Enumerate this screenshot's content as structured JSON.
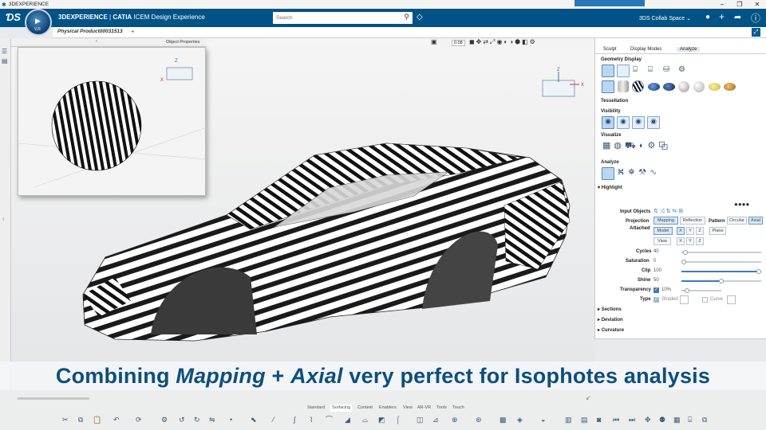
{
  "window": {
    "title": "3DEXPERIENCE",
    "minimize": "–",
    "maximize": "❐",
    "close": "✕"
  },
  "appbar": {
    "brand": "3DEXPERIENCE",
    "separator": "|",
    "product": "CATIA",
    "app": "ICEM Design Experience",
    "search_placeholder": "Search",
    "collab_space": "3DS Collab Space",
    "compass_label": "V,R"
  },
  "document": {
    "tab_label": "Physical Product00031513",
    "add_tab": "+"
  },
  "object_properties": {
    "label": "Object Properties"
  },
  "view_toolbar": {
    "zoom_value": "0.08"
  },
  "panel": {
    "tabs": [
      "Sculpt",
      "Display Modes",
      "Analyze"
    ],
    "sections": {
      "geometry_display": "Geometry Display",
      "tessellation": "Tessellation",
      "visibility": "Visibility",
      "visualize": "Visualize",
      "analyze": "Analyze",
      "highlight": "Highlight",
      "sections": "Sections",
      "deviation": "Deviation",
      "curvature": "Curvature"
    },
    "highlight": {
      "input_objects": "Input Objects",
      "projection_label": "Projection",
      "projection_options": [
        "Mapping",
        "Reflection"
      ],
      "pattern_label": "Pattern",
      "pattern_options": [
        "Circular",
        "Axial"
      ],
      "attached_label": "Attached",
      "attached_row1": [
        "Model",
        "X",
        "Y",
        "Z",
        "Plane"
      ],
      "attached_row2": [
        "View",
        "X",
        "Y",
        "Z"
      ],
      "cycles_label": "Cycles",
      "cycles_value": "40",
      "saturation_label": "Saturation",
      "saturation_value": "0",
      "clip_label": "Clip",
      "clip_value": "100",
      "shine_label": "Shine",
      "shine_value": "50",
      "transparency_label": "Transparency",
      "transparency_value": "10%",
      "type_label": "Type",
      "type_shaded": "Shaded",
      "type_curve": "Curve"
    },
    "slider_levels": {
      "cycles": 0.02,
      "saturation": 0.0,
      "clip": 1.0,
      "shine": 0.5,
      "transparency": 0.1
    }
  },
  "caption": {
    "part1": "Combining ",
    "part2": "Mapping",
    "part3": " + ",
    "part4": "Axial",
    "part5": " very perfect for Isophotes analysis"
  },
  "bottom_tabs": [
    "Standard",
    "Surfacing",
    "Context",
    "Enablers",
    "View",
    "AR-VR",
    "Tools",
    "Touch"
  ],
  "colors": {
    "appbar": "#005386",
    "caption": "#0d4f7d",
    "accent": "#4f89c2"
  }
}
